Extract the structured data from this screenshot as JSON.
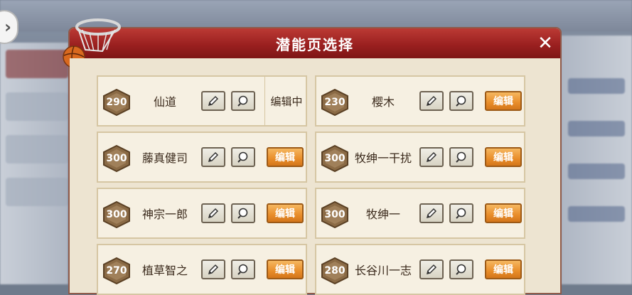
{
  "dialog": {
    "title": "潜能页选择",
    "close_icon": "close-icon",
    "edit_icon": "pencil-icon",
    "search_icon": "magnifier-icon"
  },
  "pages": [
    {
      "level": "290",
      "name": "仙道",
      "status": "编辑中"
    },
    {
      "level": "230",
      "name": "樱木",
      "action": "编辑"
    },
    {
      "level": "300",
      "name": "藤真健司",
      "action": "编辑"
    },
    {
      "level": "300",
      "name": "牧绅一干扰",
      "action": "编辑"
    },
    {
      "level": "300",
      "name": "神宗一郎",
      "action": "编辑"
    },
    {
      "level": "300",
      "name": "牧绅一",
      "action": "编辑"
    },
    {
      "level": "270",
      "name": "植草智之",
      "action": "编辑"
    },
    {
      "level": "280",
      "name": "长谷川一志",
      "action": "编辑"
    }
  ],
  "colors": {
    "title_bar": "#9b2020",
    "edit_button": "#e88d2a",
    "badge": "#8a6a45"
  }
}
